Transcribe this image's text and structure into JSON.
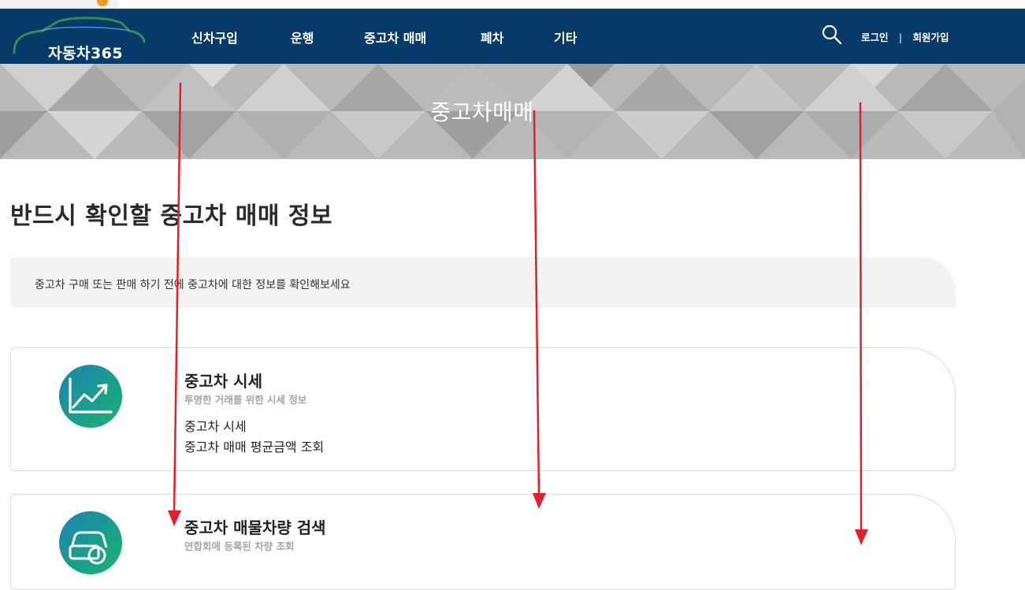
{
  "logo": {
    "text": "자동차365"
  },
  "nav": {
    "items": [
      {
        "label": "신차구입"
      },
      {
        "label": "운행"
      },
      {
        "label": "중고차 매매"
      },
      {
        "label": "폐차"
      },
      {
        "label": "기타"
      }
    ],
    "login": "로그인",
    "separator": "|",
    "signup": "회원가입"
  },
  "hero": {
    "title": "중고차매매"
  },
  "page": {
    "heading": "반드시 확인할 중고차 매매 정보",
    "notice": "중고차 구매 또는 판매 하기 전에 중고차에 대한 정보를 확인해보세요"
  },
  "cards": [
    {
      "title": "중고차 시세",
      "subtitle": "투명한 거래를 위한 시세 정보",
      "links": [
        "중고차 시세",
        "중고차 매매 평균금액 조회"
      ],
      "icon": "trend-chart-icon"
    },
    {
      "title": "중고차 매물차량 검색",
      "subtitle": "연합회에 등록된 차량 조회",
      "links": [],
      "icon": "car-search-icon"
    }
  ],
  "colors": {
    "navbar": "#063a69",
    "hero_background": "#b5b5b5",
    "annotation_arrow": "#e0202a",
    "icon_gradient_start": "#1c82b3",
    "icon_gradient_end": "#1db36d"
  }
}
